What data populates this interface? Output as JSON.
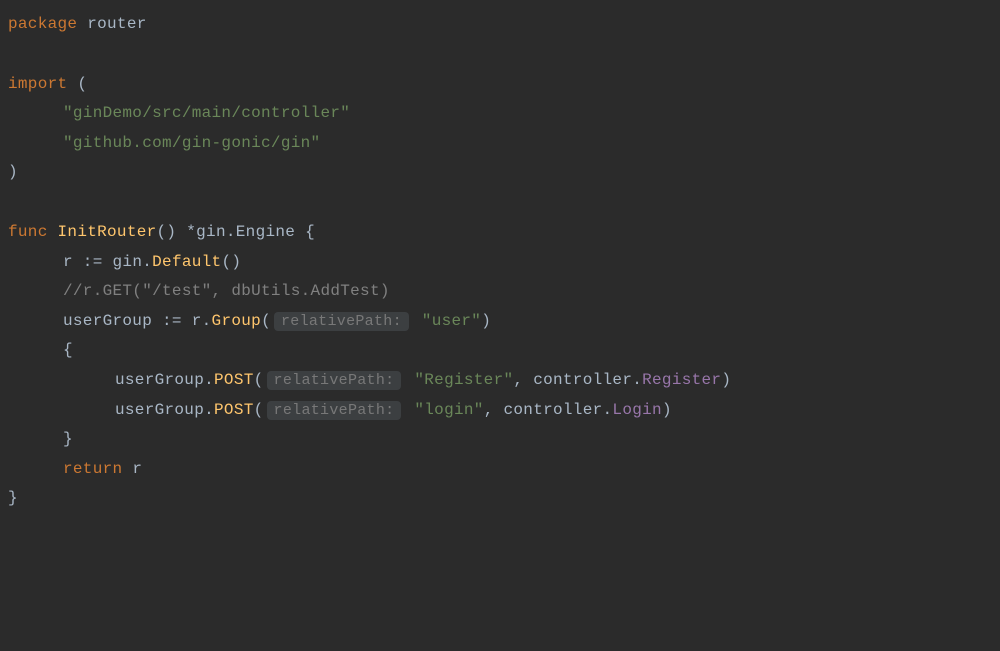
{
  "line1": {
    "kw": "package",
    "name": "router"
  },
  "line3": {
    "kw": "import",
    "open": " ("
  },
  "line4": {
    "str": "\"ginDemo/src/main/controller\""
  },
  "line5": {
    "str": "\"github.com/gin-gonic/gin\""
  },
  "line6": {
    "close": ")"
  },
  "line8": {
    "kw": "func ",
    "name": "InitRouter",
    "sig": "() *",
    "pkg": "gin",
    "dot": ".",
    "type": "Engine",
    "brace": " {"
  },
  "line9": {
    "var": "r",
    "op": " := ",
    "pkg": "gin",
    "dot": ".",
    "fn": "Default",
    "paren": "()"
  },
  "line10": {
    "comment": "//r.GET(\"/test\", dbUtils.AddTest)"
  },
  "line11": {
    "var": "userGroup",
    "op": " := ",
    "r": "r",
    "dot": ".",
    "fn": "Group",
    "open": "(",
    "hint": "relativePath:",
    "str": "\"user\"",
    "close": ")"
  },
  "line12": {
    "brace": "{"
  },
  "line13": {
    "var": "userGroup",
    "dot": ".",
    "fn": "POST",
    "open": "(",
    "hint": "relativePath:",
    "str": "\"Register\"",
    "comma": ", ",
    "ctrl": "controller",
    "dot2": ".",
    "method": "Register",
    "close": ")"
  },
  "line14": {
    "var": "userGroup",
    "dot": ".",
    "fn": "POST",
    "open": "(",
    "hint": "relativePath:",
    "str": "\"login\"",
    "comma": ", ",
    "ctrl": "controller",
    "dot2": ".",
    "method": "Login",
    "close": ")"
  },
  "line15": {
    "brace": "}"
  },
  "line16": {
    "kw": "return ",
    "var": "r"
  },
  "line17": {
    "brace": "}"
  }
}
